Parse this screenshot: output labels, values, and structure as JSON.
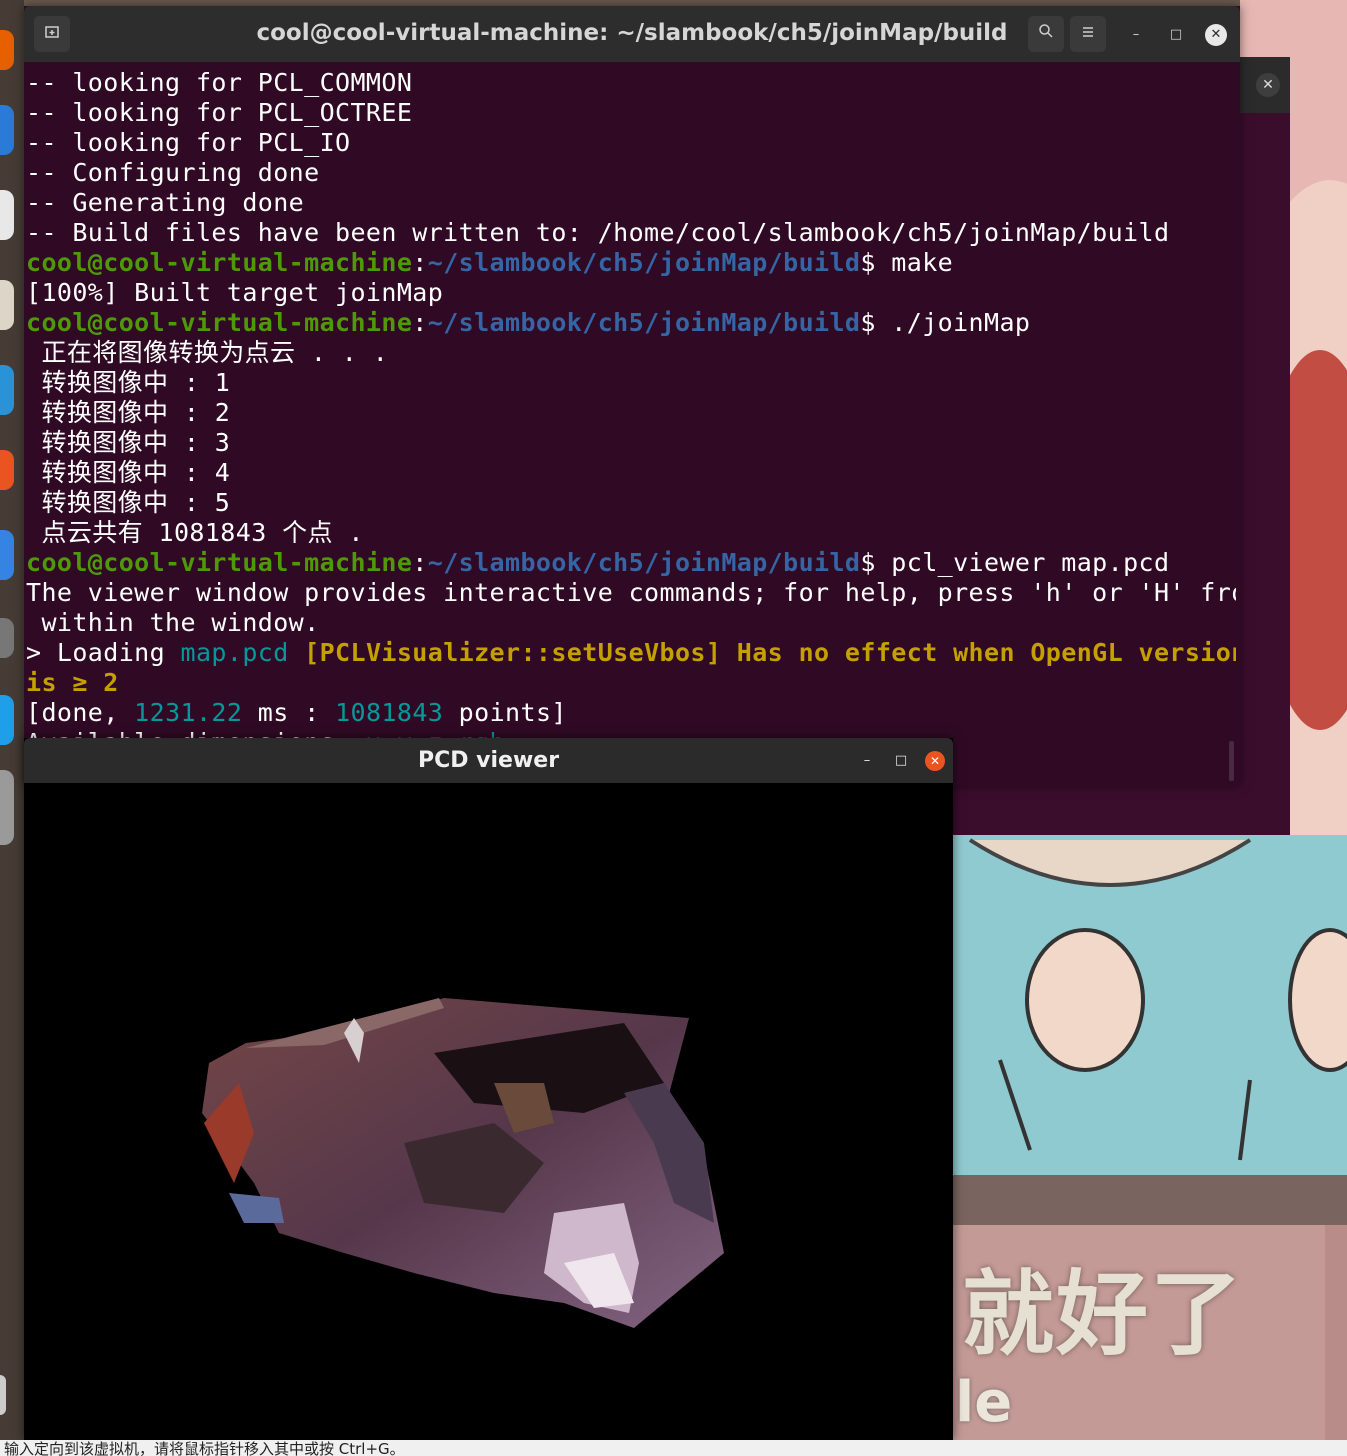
{
  "terminal": {
    "title": "cool@cool-virtual-machine: ~/slambook/ch5/joinMap/build",
    "header_icons": {
      "left": "terminal-tab-icon",
      "search": "search-icon",
      "menu": "hamburger-menu-icon"
    },
    "window_controls": {
      "minimize": "–",
      "maximize": "□",
      "close": "✕"
    },
    "prompt": {
      "user_host": "cool@cool-virtual-machine",
      "separator": ":",
      "path": "~/slambook/ch5/joinMap/build",
      "dollar": "$"
    },
    "lines": {
      "l1": "-- looking for PCL_COMMON",
      "l2": "-- looking for PCL_OCTREE",
      "l3": "-- looking for PCL_IO",
      "l4": "-- Configuring done",
      "l5": "-- Generating done",
      "l6": "-- Build files have been written to: /home/cool/slambook/ch5/joinMap/build",
      "cmd1": " make",
      "l8": "[100%] Built target joinMap",
      "cmd2": " ./joinMap",
      "l10": " 正在将图像转换为点云 . . .",
      "l11": " 转换图像中 : 1",
      "l12": " 转换图像中 : 2",
      "l13": " 转换图像中 : 3",
      "l14": " 转换图像中 : 4",
      "l15": " 转换图像中 : 5",
      "l16": " 点云共有 1081843 个点 .",
      "cmd3": " pcl_viewer map.pcd",
      "l18": "The viewer window provides interactive commands; for help, press 'h' or 'H' from",
      "l19": " within the window.",
      "l20_a": "> Loading ",
      "l20_b": "map.pcd",
      "l20_c": " [PCLVisualizer::setUseVbos] Has no effect when OpenGL version",
      "l21": "is ≥ 2",
      "l22_a": "[done, ",
      "l22_b": "1231.22",
      "l22_c": " ms : ",
      "l22_d": "1081843",
      "l22_e": " points]",
      "l23_a": "Available dimensions: ",
      "l23_b": "x y z rgb"
    }
  },
  "back_window": {
    "close": "✕"
  },
  "pcd_viewer": {
    "title": "PCD viewer",
    "window_controls": {
      "minimize": "–",
      "maximize": "□",
      "close": "✕"
    }
  },
  "wallpaper": {
    "caption": "就好了",
    "caption_sub": "le"
  },
  "statusbar": {
    "text": "输入定向到该虚拟机，请将鼠标指针移入其中或按 Ctrl+G。"
  },
  "colors": {
    "terminal_bg": "#300a24",
    "prompt_green": "#4e9a06",
    "prompt_blue": "#3465a4",
    "warning_yellow": "#c4a000",
    "value_cyan": "#06989a",
    "close_orange": "#e95420"
  }
}
